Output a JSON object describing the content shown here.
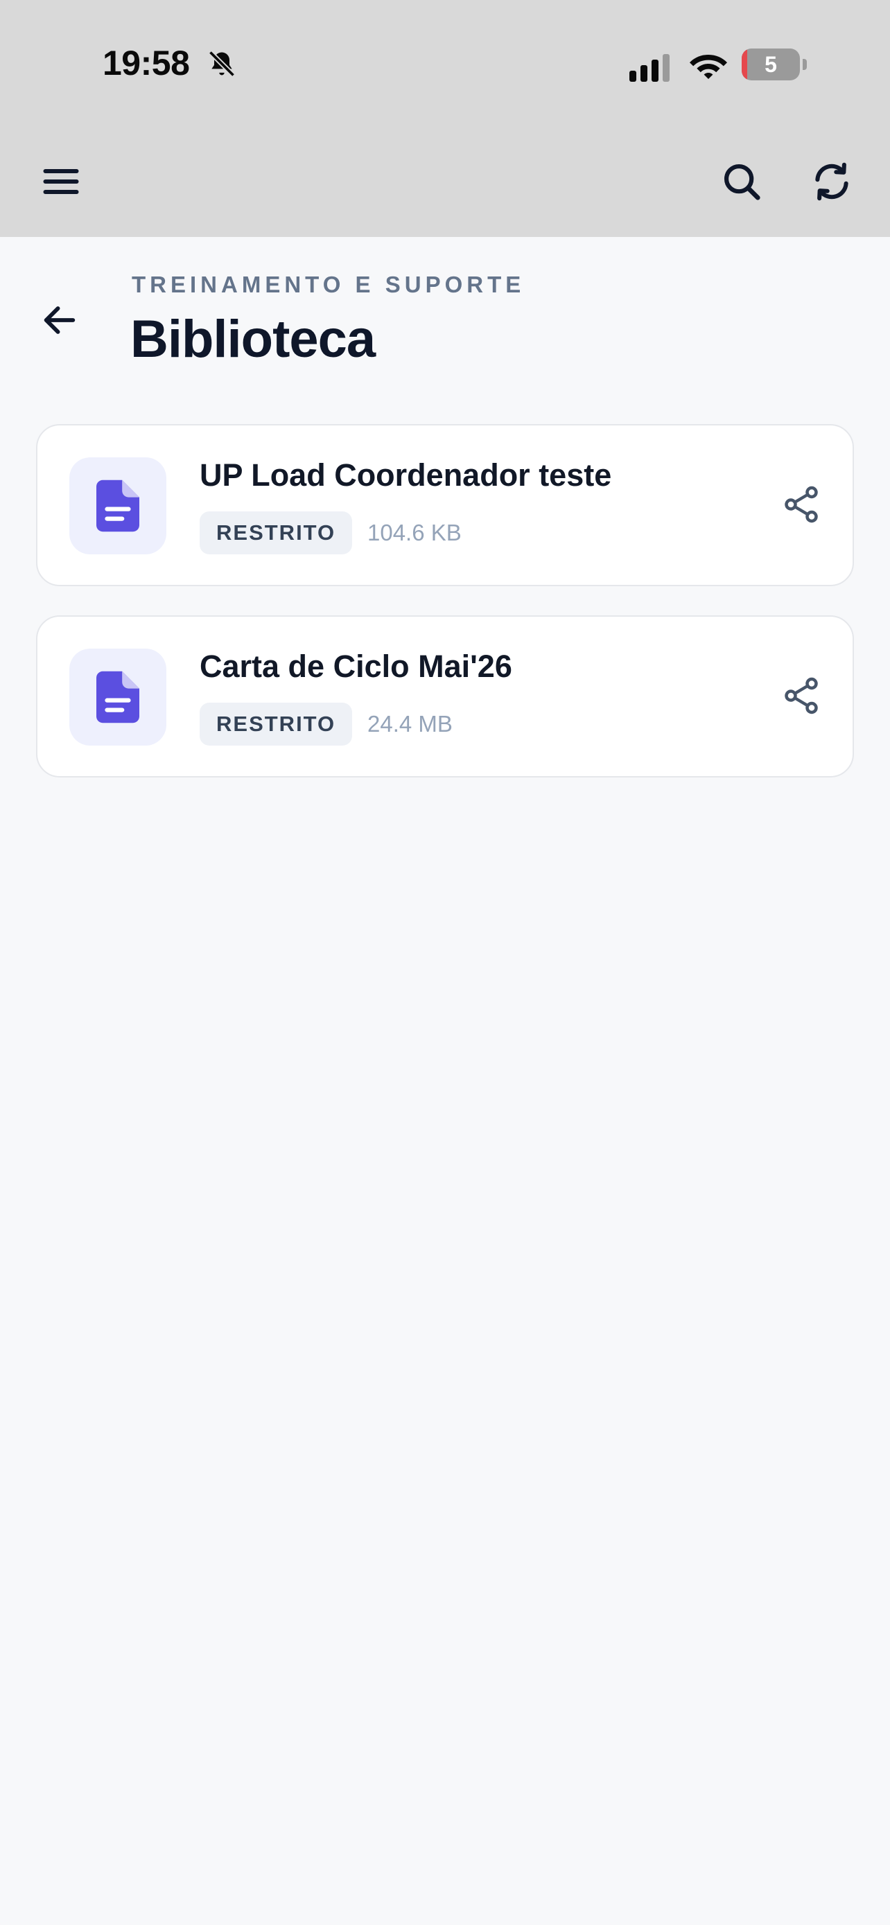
{
  "status_bar": {
    "time": "19:58",
    "battery_level": "5",
    "battery_color": "#E5484D"
  },
  "app_bar": {
    "background": "#D9D9D9",
    "left_icon": "menu-icon",
    "right_icons": [
      "search-icon",
      "refresh-icon"
    ]
  },
  "header": {
    "eyebrow": "TREINAMENTO E SUPORTE",
    "title": "Biblioteca",
    "back_icon": "arrow-left-icon"
  },
  "files": [
    {
      "name": "UP Load Coordenador teste",
      "access": "RESTRITO",
      "size": "104.6 KB",
      "icon": "document-icon",
      "action_icon": "share-icon"
    },
    {
      "name": "Carta de Ciclo Mai'26",
      "access": "RESTRITO",
      "size": "24.4 MB",
      "icon": "document-icon",
      "action_icon": "share-icon"
    }
  ],
  "colors": {
    "accent": "#5B4FE0",
    "icon_bg": "#EEF0FD",
    "page_bg": "#F7F8FA"
  }
}
